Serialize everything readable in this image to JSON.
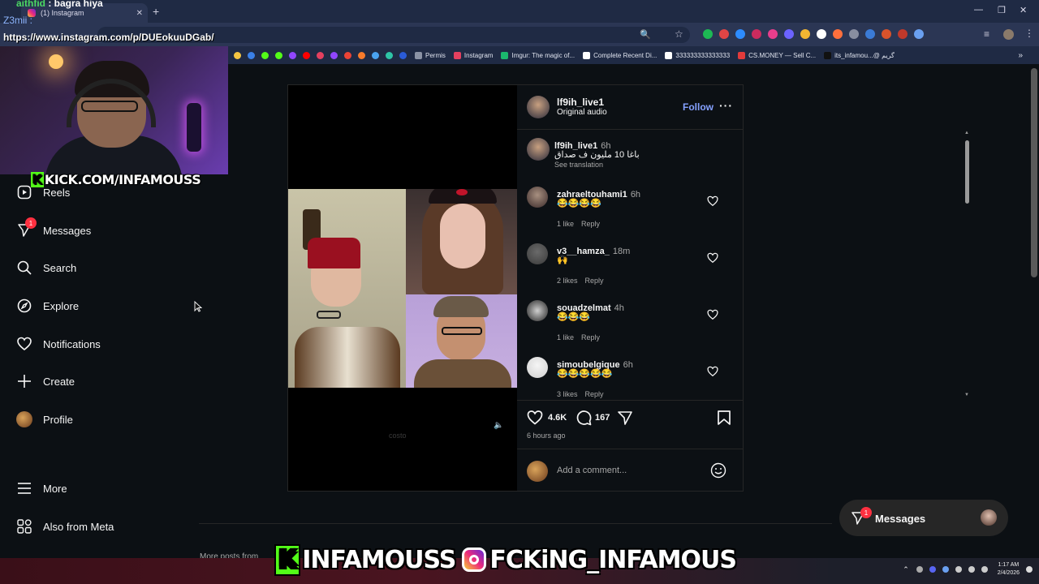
{
  "overlay": {
    "chat_user": "aithfid",
    "chat_message": ": bagra hiya",
    "chat_line2": "Z3mii :",
    "url_caption": "https://www.instagram.com/p/DUEokuuDGab/",
    "kick_tag": "KICK.COM/INFAMOUSS",
    "kick_letter": "K",
    "banner_kick": "INFAMOUSS",
    "banner_ig": "FCKiNG_INFAMOUS"
  },
  "browser": {
    "tab_title": "(1) Instagram",
    "bookmarks": [
      {
        "label": "Permis",
        "color": "#8b93a5"
      },
      {
        "label": "Instagram",
        "color": "#e4405f"
      },
      {
        "label": "Imgur: The magic of...",
        "color": "#1bb76e"
      },
      {
        "label": "Complete Recent Di...",
        "color": "#ffffff"
      },
      {
        "label": "333333333333333",
        "color": "#ffffff"
      },
      {
        "label": "CS.MONEY — Sell C...",
        "color": "#e23b3b"
      },
      {
        "label": "its_infamou...@ گريم",
        "color": "#111111"
      }
    ]
  },
  "sidebar": {
    "items": [
      {
        "label": "Reels",
        "icon": "reels-icon"
      },
      {
        "label": "Messages",
        "icon": "messages-icon",
        "badge": "1"
      },
      {
        "label": "Search",
        "icon": "search-icon"
      },
      {
        "label": "Explore",
        "icon": "explore-icon"
      },
      {
        "label": "Notifications",
        "icon": "heart-icon"
      },
      {
        "label": "Create",
        "icon": "plus-icon"
      },
      {
        "label": "Profile",
        "icon": "profile-avatar"
      },
      {
        "label": "More",
        "icon": "menu-icon"
      },
      {
        "label": "Also from Meta",
        "icon": "meta-icon"
      }
    ]
  },
  "post": {
    "author": "lf9ih_live1",
    "audio": "Original audio",
    "follow_label": "Follow",
    "caption": {
      "user": "lf9ih_live1",
      "time": "6h",
      "text": "باغا 10 مليون ف صداق",
      "see_translation": "See translation"
    },
    "watermark": "costo",
    "comments": [
      {
        "user": "zahraeltouhami1",
        "time": "6h",
        "text": "😂😂😂😂",
        "likes": "1 like",
        "reply": "Reply"
      },
      {
        "user": "v3__hamza_",
        "time": "18m",
        "text": "🙌",
        "likes": "2 likes",
        "reply": "Reply"
      },
      {
        "user": "souadzelmat",
        "time": "4h",
        "text": "😂😂😂",
        "likes": "1 like",
        "reply": "Reply"
      },
      {
        "user": "simoubelgique",
        "time": "6h",
        "text": "😂😂😂😂😂",
        "likes": "3 likes",
        "reply": "Reply"
      }
    ],
    "like_count": "4.6K",
    "comment_count": "167",
    "posted": "6 hours ago",
    "add_comment_placeholder": "Add a comment..."
  },
  "messages_pill": {
    "label": "Messages",
    "badge": "1"
  },
  "more_posts": "More posts from",
  "taskbar": {
    "time": "1:17 AM",
    "date": "2/4/2026"
  }
}
